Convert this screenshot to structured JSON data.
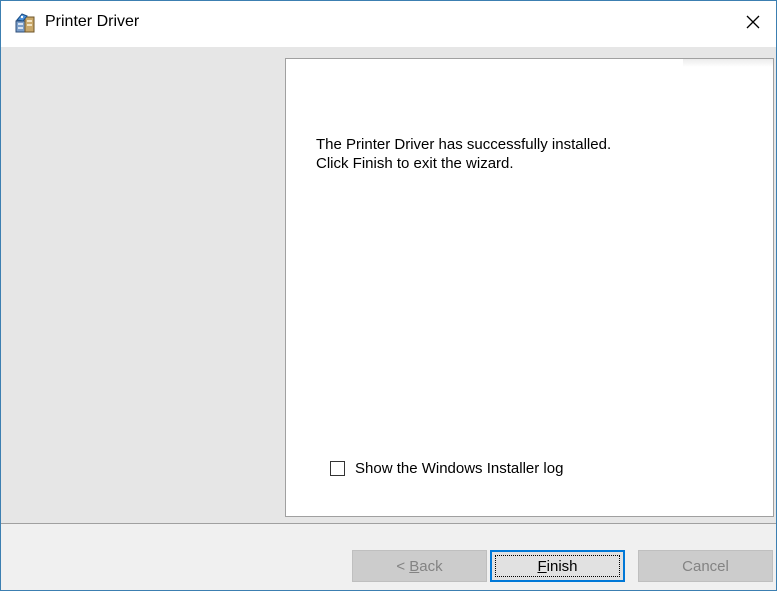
{
  "window": {
    "title": "Printer Driver",
    "icon": "installer-package-icon",
    "close_glyph": "✕"
  },
  "panel": {
    "message_line1": "The Printer Driver has successfully installed.",
    "message_line2": "Click Finish to exit the wizard.",
    "checkbox_label": "Show the Windows Installer log",
    "checkbox_checked": false
  },
  "footer": {
    "back_prefix": "< ",
    "back_accel": "B",
    "back_rest": "ack",
    "finish_accel": "F",
    "finish_rest": "inish",
    "cancel_label": "Cancel"
  },
  "colors": {
    "window_border": "#3c7fb1",
    "accent_focus": "#0078d7",
    "disabled_button": "#cccccc"
  }
}
